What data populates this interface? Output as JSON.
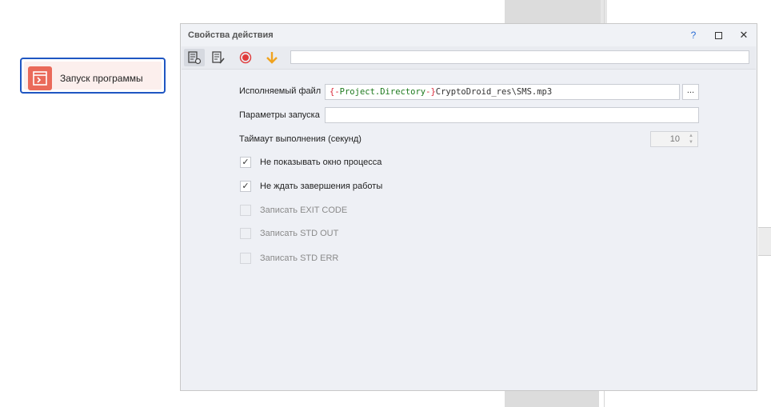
{
  "node": {
    "label": "Запуск программы"
  },
  "dialog": {
    "title": "Свойства действия",
    "help_label": "?",
    "close_label": "✕",
    "toolbar": {
      "input_value": ""
    },
    "exec_file": {
      "label": "Исполняемый файл",
      "brace_open": "{-",
      "var_name": "Project.Directory",
      "brace_close": "-}",
      "rest": "CryptoDroid_res\\SMS.mp3",
      "browse_label": "..."
    },
    "params": {
      "label": "Параметры запуска",
      "value": ""
    },
    "timeout": {
      "label": "Таймаут выполнения (секунд)",
      "value": "10"
    },
    "checkboxes": [
      {
        "label": "Не показывать окно процесса",
        "checked": true,
        "mark": "✓"
      },
      {
        "label": "Не ждать завершения работы",
        "checked": true,
        "mark": "✓"
      },
      {
        "label": "Записать EXIT CODE",
        "checked": false,
        "mark": ""
      },
      {
        "label": "Записать STD OUT",
        "checked": false,
        "mark": ""
      },
      {
        "label": "Записать STD ERR",
        "checked": false,
        "mark": ""
      }
    ]
  }
}
